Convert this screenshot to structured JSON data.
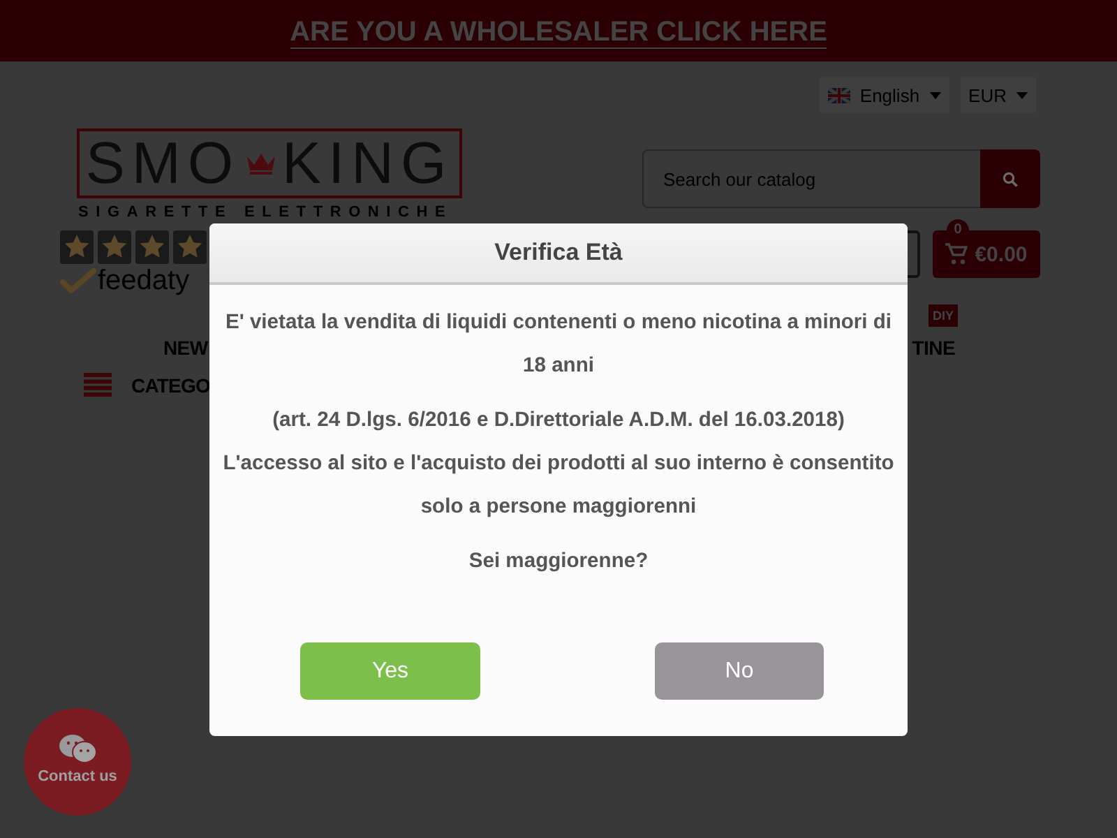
{
  "promo_banner": {
    "link": "ARE YOU A WHOLESALER CLICK HERE"
  },
  "header": {
    "language": {
      "label": "English"
    },
    "currency": {
      "label": "EUR"
    },
    "logo": {
      "word_1": "SMO",
      "word_2": "KING",
      "tagline": "SIGARETTE ELETTRONICHE"
    },
    "rating": {
      "stars": 4,
      "brand": "feedaty"
    },
    "search": {
      "placeholder": "Search our catalog"
    },
    "cart": {
      "count": "0",
      "total": "€0.00"
    }
  },
  "nav": {
    "items": [
      {
        "label": "NEW"
      },
      {
        "label": "TINE",
        "badge": "DIY"
      }
    ],
    "categories": {
      "label": "CATEGO"
    }
  },
  "dialog": {
    "title": "Verifica Età",
    "paragraphs": [
      [
        "E' vietata la vendita di liquidi contenenti o meno nicotina a minori di 18 anni"
      ],
      [
        "(art. 24 D.lgs. 6/2016 e D.Direttoriale A.D.M. del 16.03.2018)",
        "L'accesso al sito e l'acquisto dei prodotti al suo interno è consentito solo a persone maggiorenni"
      ],
      [
        "Sei maggiorenne?"
      ]
    ],
    "buttons": [
      {
        "label": "Yes",
        "kind": "confirm"
      },
      {
        "label": "No",
        "kind": "cancel"
      }
    ]
  },
  "contact_button": {
    "label": "Contact us"
  }
}
